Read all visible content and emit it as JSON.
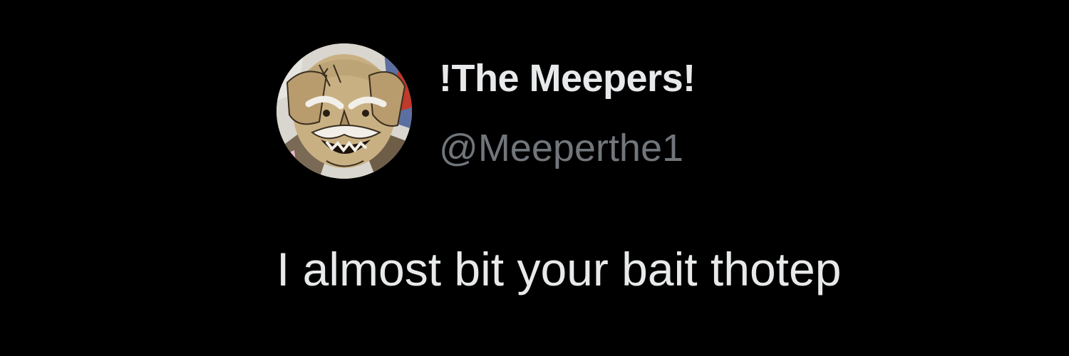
{
  "tweet": {
    "author": {
      "display_name": "!The Meepers!",
      "handle": "@Meeperthe1",
      "avatar": "comic-character-portrait"
    },
    "text": "I almost bit your bait thotep"
  },
  "colors": {
    "background": "#000000",
    "primary_text": "#e7e9ea",
    "secondary_text": "#71767b"
  }
}
